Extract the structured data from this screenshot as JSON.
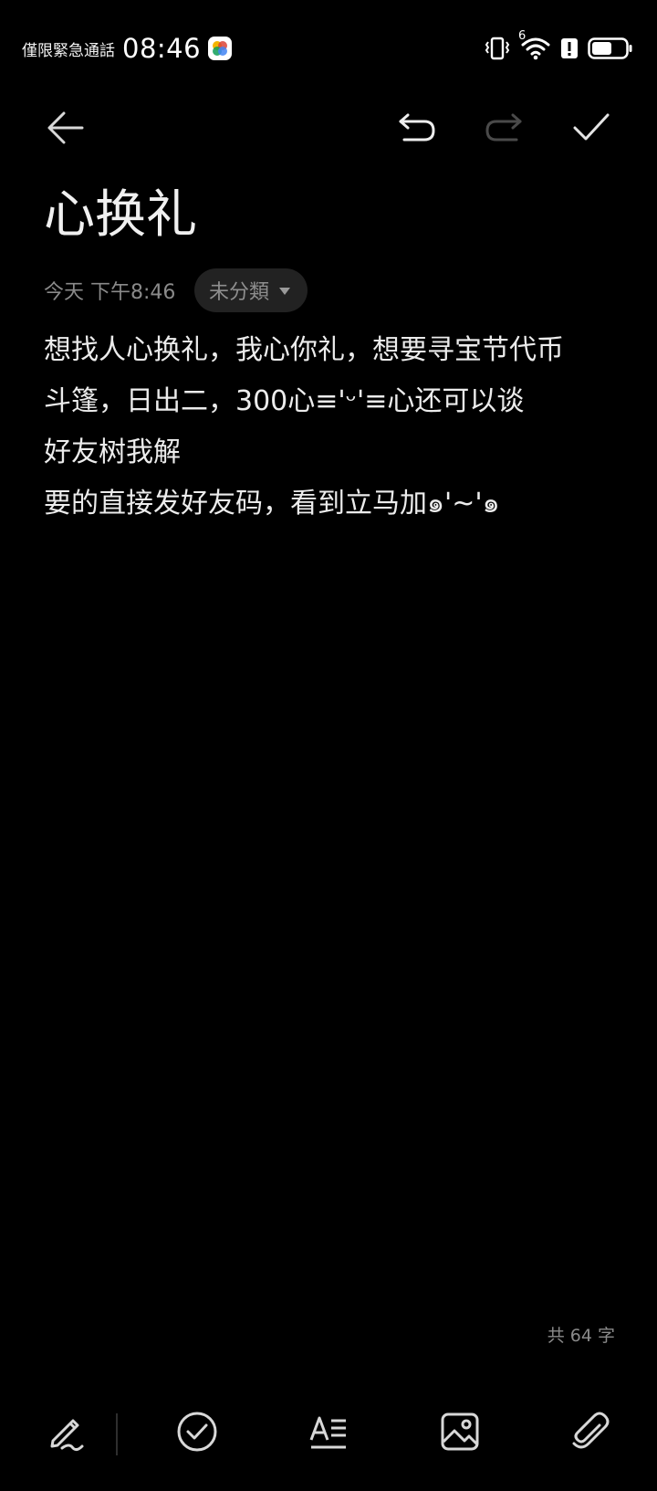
{
  "status_bar": {
    "carrier": "僅限緊急通話",
    "time": "08:46",
    "network_label": "6"
  },
  "toolbar": {
    "back_icon": "arrow-left-icon",
    "undo_icon": "undo-icon",
    "redo_icon": "redo-icon",
    "done_icon": "check-icon"
  },
  "note": {
    "title": "心换礼",
    "date": "今天",
    "time": "下午8:46",
    "category": "未分類",
    "lines": [
      "想找人心换礼，我心你礼，想要寻宝节代币",
      "斗篷，日出二，300心≡'ᵕ'≡心还可以谈",
      "好友树我解",
      "要的直接发好友码，看到立马加๑'~'๑"
    ],
    "word_count": "共 64 字"
  },
  "bottom_toolbar": {
    "items": [
      "handwriting-pen-icon",
      "checklist-icon",
      "text-format-icon",
      "image-icon",
      "attachment-paperclip-icon"
    ]
  },
  "colors": {
    "background": "#000000",
    "text": "#ececec",
    "muted": "#8a8a8a",
    "chip": "#222222"
  }
}
